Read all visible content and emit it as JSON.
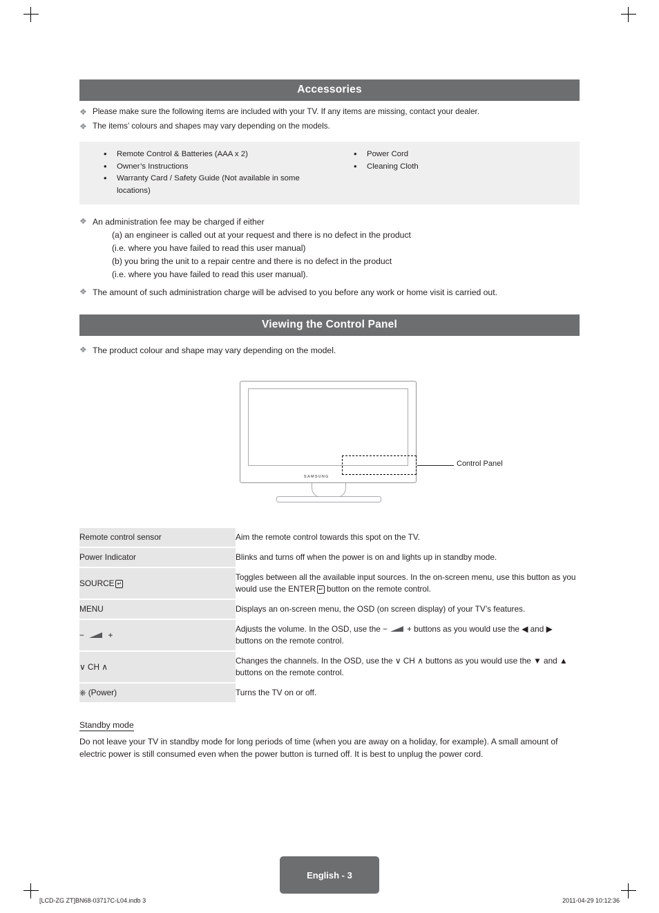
{
  "sections": {
    "accessories_title": "Accessories",
    "control_panel_title": "Viewing the Control Panel"
  },
  "notes": {
    "note1": "Please make sure the following items are included with your TV. If any items are missing, contact your dealer.",
    "note2": "The items’ colours and shapes may vary depending on the models.",
    "note3": "The amount of such administration charge will be advised to you before any work or home visit is carried out.",
    "note4": "The product colour and shape may vary depending on the model."
  },
  "accessories": {
    "left": [
      "Remote Control & Batteries (AAA x 2)",
      "Owner’s Instructions",
      "Warranty Card / Safety Guide (Not available in some locations)"
    ],
    "right": [
      "Power Cord",
      "Cleaning Cloth"
    ]
  },
  "admin": {
    "intro": "An administration fee may be charged if either",
    "line_a": "(a) an engineer is called out at your request and there is no defect in the product",
    "line_a2": "(i.e. where you have failed to read this user manual)",
    "line_b": "(b) you bring the unit to a repair centre and there is no defect in the product",
    "line_b2": "(i.e. where you have failed to read this user manual)."
  },
  "tv_diagram": {
    "brand": "SAMSUNG",
    "callout": "Control Panel"
  },
  "control_table": {
    "rows": [
      {
        "label": "Remote control sensor",
        "desc": "Aim the remote control towards this spot on the TV."
      },
      {
        "label": "Power Indicator",
        "desc": "Blinks and turns off when the power is on and lights up in standby mode."
      },
      {
        "label": "SOURCE",
        "label_icon": "enter-icon",
        "desc_part1": "Toggles between all the available input sources. In the on-screen menu, use this button as you would use the ",
        "desc_keyword": "ENTER",
        "desc_part2": " button on the remote control."
      },
      {
        "label": "MENU",
        "desc": "Displays an on-screen menu, the OSD (on screen display) of your TV’s features."
      },
      {
        "label_minus": "−",
        "label_plus": "+",
        "label_icon": "volume-icon",
        "desc_part1": "Adjusts the volume. In the OSD, use the ",
        "desc_minus": "−",
        "desc_plus": "+",
        "desc_part2": " buttons as you would use the ◀ and ▶ buttons on the remote control."
      },
      {
        "label": "CH",
        "label_down": "∨",
        "label_up": "∧",
        "desc_part1": "Changes the channels. In the OSD, use the ",
        "desc_keyword": "CH",
        "desc_part2": " buttons as you would use the ▼ and ▲ buttons on the remote control."
      },
      {
        "label": "(Power)",
        "label_icon": "power-icon",
        "desc": "Turns the TV on or off."
      }
    ]
  },
  "standby": {
    "heading": "Standby mode",
    "body": "Do not leave your TV in standby mode for long periods of time (when you are away on a holiday, for example). A small amount of electric power is still consumed even when the power button is turned off. It is best to unplug the power cord."
  },
  "footer": {
    "page_label": "English - 3",
    "file_ref": "[LCD-ZG ZT]BN68-03717C-L04.indb   3",
    "timestamp": "2011-04-29   10:12:36"
  }
}
